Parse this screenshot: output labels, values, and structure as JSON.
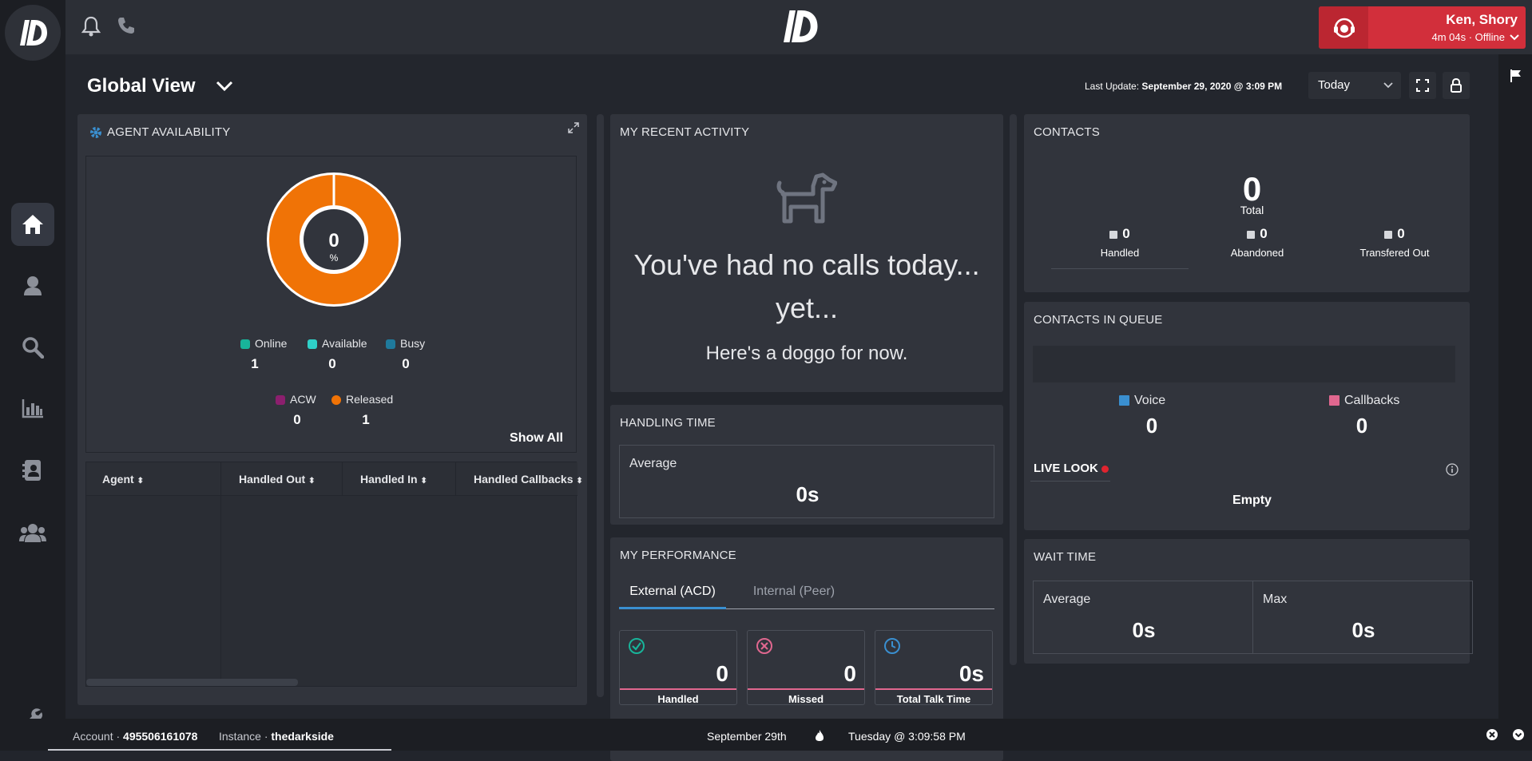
{
  "header": {
    "agent_name": "Ken, Shory",
    "agent_status": "4m 04s · Offline"
  },
  "page": {
    "title": "Global View",
    "last_update_label": "Last Update:",
    "last_update_value": "September 29, 2020 @ 3:09 PM",
    "range_select": "Today"
  },
  "agent_availability": {
    "title": "AGENT AVAILABILITY",
    "donut_value": "0",
    "donut_unit": "%",
    "released_fraction": 1.0,
    "legend": [
      {
        "label": "Online",
        "value": "1",
        "color": "#18b49a"
      },
      {
        "label": "Available",
        "value": "0",
        "color": "#2fd0c8"
      },
      {
        "label": "Busy",
        "value": "0",
        "color": "#1f7a9c"
      },
      {
        "label": "ACW",
        "value": "0",
        "color": "#8c1f6e"
      },
      {
        "label": "Released",
        "value": "1",
        "color": "#f07306"
      }
    ],
    "show_all": "Show All",
    "table_headers": [
      "Agent",
      "Handled Out",
      "Handled In",
      "Handled Callbacks"
    ]
  },
  "recent_activity": {
    "title": "MY RECENT ACTIVITY",
    "line1": "You've had no calls today...",
    "line2": "yet...",
    "line3": "Here's a doggo for now."
  },
  "handling_time": {
    "title": "HANDLING TIME",
    "average_label": "Average",
    "average_value": "0s"
  },
  "performance": {
    "title": "MY PERFORMANCE",
    "tabs": [
      "External (ACD)",
      "Internal (Peer)"
    ],
    "cards": [
      {
        "value": "0",
        "label": "Handled"
      },
      {
        "value": "0",
        "label": "Missed"
      },
      {
        "value": "0s",
        "label": "Total Talk Time"
      }
    ]
  },
  "contacts": {
    "title": "CONTACTS",
    "total_value": "0",
    "total_label": "Total",
    "stats": [
      {
        "value": "0",
        "label": "Handled"
      },
      {
        "value": "0",
        "label": "Abandoned"
      },
      {
        "value": "0",
        "label": "Transfered Out"
      }
    ]
  },
  "queue": {
    "title": "CONTACTS IN QUEUE",
    "voice_label": "Voice",
    "voice_value": "0",
    "callbacks_label": "Callbacks",
    "callbacks_value": "0",
    "live_look_label": "LIVE LOOK",
    "live_look_value": "Empty"
  },
  "wait_time": {
    "title": "WAIT TIME",
    "average_label": "Average",
    "average_value": "0s",
    "max_label": "Max",
    "max_value": "0s"
  },
  "footer": {
    "account_label": "Account ·",
    "account_value": "495506161078",
    "instance_label": "Instance ·",
    "instance_value": "thedarkside",
    "date": "September 29th",
    "time": "Tuesday @ 3:09:58 PM"
  },
  "colors": {
    "accent_red": "#d22f3b",
    "released_orange": "#f07306"
  }
}
